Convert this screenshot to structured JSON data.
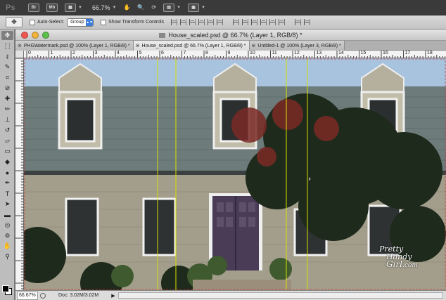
{
  "app": {
    "logo": "Ps",
    "zoom": "66.7%"
  },
  "appbar": {
    "buttons": [
      {
        "name": "bridge-button",
        "label": "Br"
      },
      {
        "name": "minibridge-button",
        "label": "Mb"
      }
    ]
  },
  "options": {
    "auto_select_label": "Auto-Select:",
    "auto_select_value": "Group",
    "transform_label": "Show Transform Controls"
  },
  "document": {
    "title": "House_scaled.psd @ 66.7% (Layer 1, RGB/8) *",
    "tabs": [
      {
        "label": "PHGWatermark.psd @ 100% (Layer 1, RGB/8) *"
      },
      {
        "label": "House_scaled.psd @ 66.7% (Layer 1, RGB/8) *"
      },
      {
        "label": "Untitled-1 @ 100% (Layer 3, RGB/8) *"
      }
    ],
    "ruler": [
      "0",
      "1",
      "2",
      "3",
      "4",
      "5",
      "6",
      "7",
      "8",
      "9",
      "10",
      "11",
      "12",
      "13",
      "14",
      "15",
      "16",
      "17",
      "18"
    ]
  },
  "status": {
    "zoom": "66.67%",
    "doc": "Doc: 3.02M/3.02M"
  },
  "watermark": {
    "line1": "Pretty",
    "line2": "Handy",
    "line3": "Girl",
    "line4": ".com"
  }
}
